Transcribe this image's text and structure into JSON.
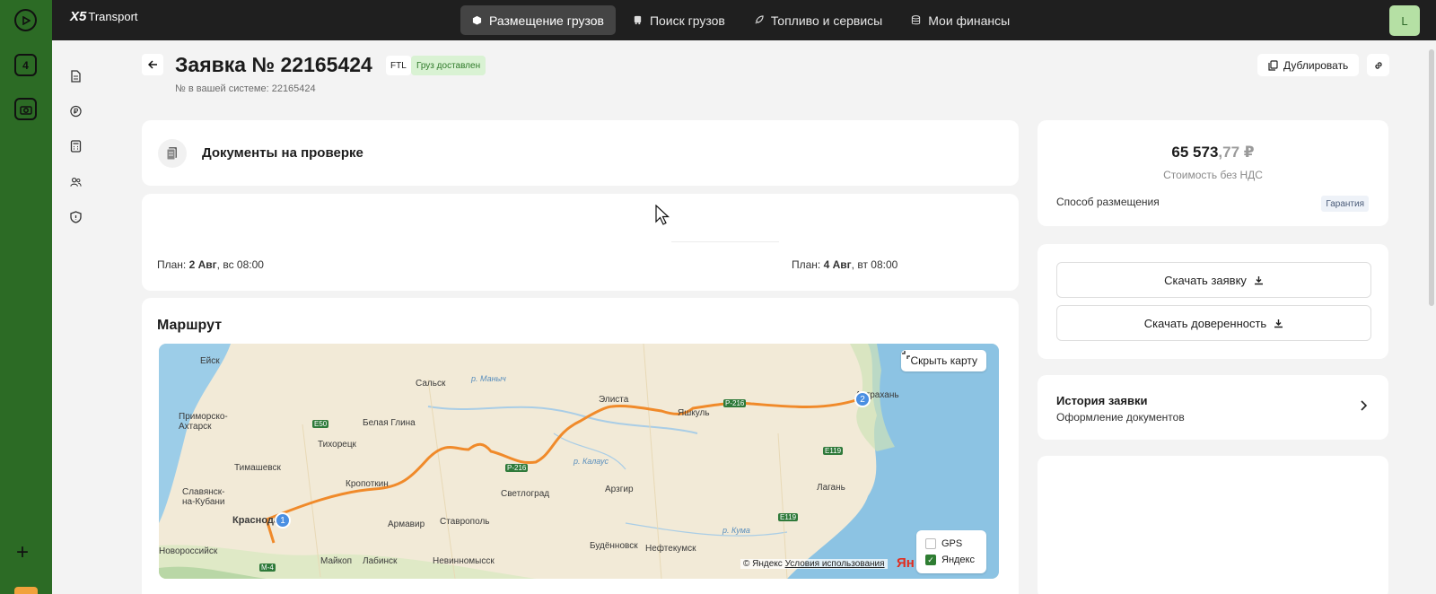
{
  "outer_bar": {
    "badge": "4"
  },
  "app": {
    "logo_mark": "X5",
    "logo_text": "Transport"
  },
  "nav": {
    "items": [
      {
        "label": "Размещение грузов",
        "icon": "box-icon"
      },
      {
        "label": "Поиск грузов",
        "icon": "truck-icon"
      },
      {
        "label": "Топливо и сервисы",
        "icon": "rocket-icon"
      },
      {
        "label": "Мои финансы",
        "icon": "database-icon"
      }
    ],
    "active_index": 0,
    "avatar": "L"
  },
  "sidebar": {
    "icons": [
      "document-icon",
      "ruble-icon",
      "calculator-icon",
      "users-icon",
      "shield-icon"
    ]
  },
  "header": {
    "title": "Заявка № 22165424",
    "type": "FTL",
    "status": "Груз доставлен",
    "subtitle": "№ в вашей системе: 22165424",
    "duplicate_label": "Дублировать"
  },
  "documents": {
    "title": "Документы на проверке"
  },
  "plan": {
    "left": {
      "prefix": "План: ",
      "date": "2 Авг",
      "rest": ", вс 08:00"
    },
    "right": {
      "prefix": "План: ",
      "date": "4 Авг",
      "rest": ", вт 08:00"
    }
  },
  "route": {
    "title": "Маршрут",
    "hide_map_label": "Скрыть карту",
    "layers": [
      {
        "label": "GPS",
        "checked": false
      },
      {
        "label": "Яндекс",
        "checked": true
      }
    ],
    "copyright_prefix": "© Яндекс",
    "copyright_link": "Условия использования",
    "logo": "Ян",
    "pins": [
      "1",
      "2"
    ],
    "cities": [
      "Ейск",
      "Сальск",
      "Элиста",
      "Астрахань",
      "Приморско-Ахтарск",
      "Белая Глина",
      "Тихорецк",
      "Яшкуль",
      "Тимашевск",
      "Кропоткин",
      "Славянск-на-Кубани",
      "Светлоград",
      "Арзгир",
      "Лагань",
      "Краснодар",
      "Армавир",
      "Ставрополь",
      "Новороссийск",
      "Майкоп",
      "Лабинск",
      "Невинномысск",
      "Будённовск",
      "Нефтекумск"
    ],
    "rivers": [
      "р. Маныч",
      "р. Калаус",
      "р. Кума"
    ],
    "roads": [
      "Е50",
      "Р-216",
      "Е119",
      "М-4"
    ],
    "route_color": "#f08a2a"
  },
  "price": {
    "main": "65 573",
    "cents": ",77 ₽",
    "label": "Стоимость без НДС",
    "placement_label": "Способ размещения",
    "placement_value": "Гарантия"
  },
  "downloads": {
    "request_label": "Скачать заявку",
    "power_label": "Скачать доверенность"
  },
  "history": {
    "title": "История заявки",
    "subtitle": "Оформление документов"
  },
  "colors": {
    "outer_bar": "#2c6b25",
    "topbar": "#1f1f1f",
    "status_bg": "#d9f2d3",
    "status_text": "#2f7a2a",
    "avatar_bg": "#b5e0a4"
  }
}
